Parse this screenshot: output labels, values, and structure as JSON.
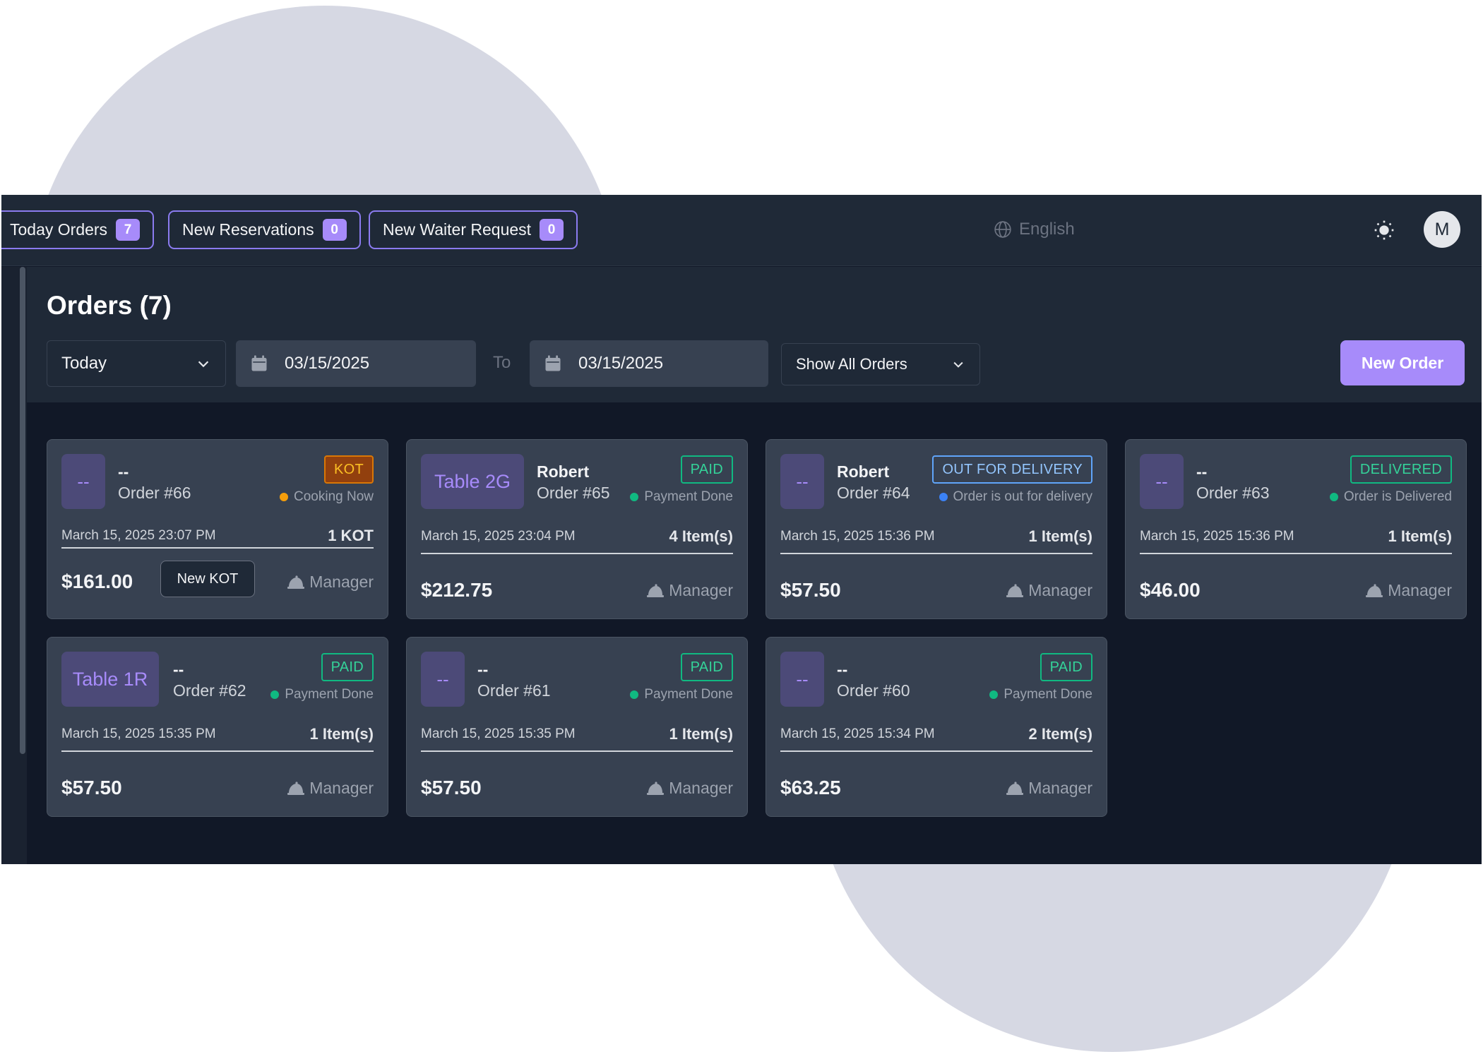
{
  "header": {
    "tabs": [
      {
        "label": "Today Orders",
        "count": "7"
      },
      {
        "label": "New Reservations",
        "count": "0"
      },
      {
        "label": "New Waiter Request",
        "count": "0"
      }
    ],
    "language": "English",
    "avatar_initial": "M"
  },
  "page": {
    "title": "Orders (7)",
    "range_select": "Today",
    "date_from": "03/15/2025",
    "to_label": "To",
    "date_to": "03/15/2025",
    "filter_select": "Show All Orders",
    "new_order_label": "New Order"
  },
  "colors": {
    "accent": "#a78bfa",
    "green_dot": "#10b981",
    "amber_dot": "#f59e0b",
    "blue_dot": "#3b82f6"
  },
  "orders": [
    {
      "tag": "--",
      "customer": "--",
      "order": "Order #66",
      "status": "KOT",
      "substatus": "Cooking Now",
      "datetime": "March 15, 2025 23:07 PM",
      "items": "1 KOT",
      "price": "$161.00",
      "action": "New KOT",
      "waiter": "Manager"
    },
    {
      "tag": "Table 2G",
      "customer": "Robert",
      "order": "Order #65",
      "status": "PAID",
      "substatus": "Payment Done",
      "datetime": "March 15, 2025 23:04 PM",
      "items": "4 Item(s)",
      "price": "$212.75",
      "waiter": "Manager"
    },
    {
      "tag": "--",
      "customer": "Robert",
      "order": "Order #64",
      "status": "OUT FOR DELIVERY",
      "substatus": "Order is out for delivery",
      "datetime": "March 15, 2025 15:36 PM",
      "items": "1 Item(s)",
      "price": "$57.50",
      "waiter": "Manager"
    },
    {
      "tag": "--",
      "customer": "--",
      "order": "Order #63",
      "status": "DELIVERED",
      "substatus": "Order is Delivered",
      "datetime": "March 15, 2025 15:36 PM",
      "items": "1 Item(s)",
      "price": "$46.00",
      "waiter": "Manager"
    },
    {
      "tag": "Table 1R",
      "customer": "--",
      "order": "Order #62",
      "status": "PAID",
      "substatus": "Payment Done",
      "datetime": "March 15, 2025 15:35 PM",
      "items": "1 Item(s)",
      "price": "$57.50",
      "waiter": "Manager"
    },
    {
      "tag": "--",
      "customer": "--",
      "order": "Order #61",
      "status": "PAID",
      "substatus": "Payment Done",
      "datetime": "March 15, 2025 15:35 PM",
      "items": "1 Item(s)",
      "price": "$57.50",
      "waiter": "Manager"
    },
    {
      "tag": "--",
      "customer": "--",
      "order": "Order #60",
      "status": "PAID",
      "substatus": "Payment Done",
      "datetime": "March 15, 2025 15:34 PM",
      "items": "2 Item(s)",
      "price": "$63.25",
      "waiter": "Manager"
    }
  ]
}
